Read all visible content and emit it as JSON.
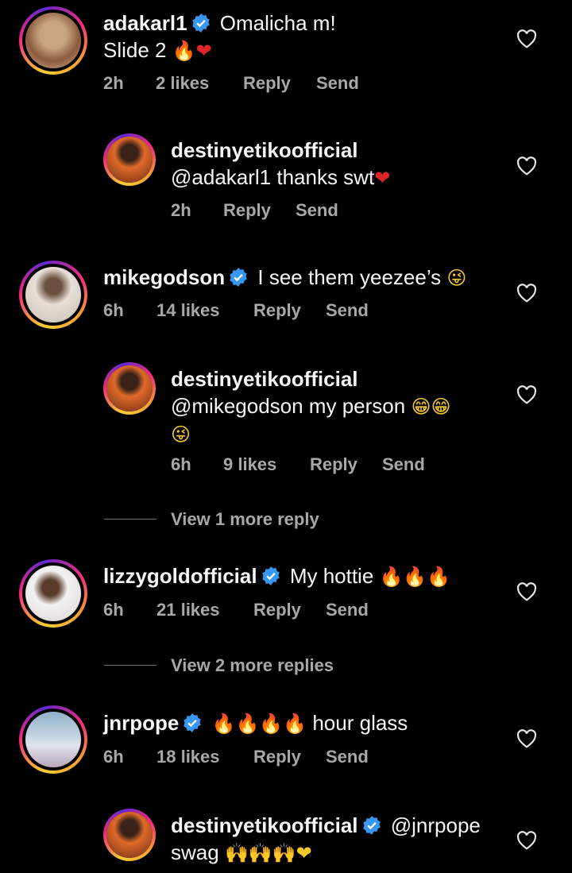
{
  "comments": [
    {
      "username": "adakarl1",
      "verified": true,
      "text_line1": "Omalicha m!",
      "text_line2": "Slide 2",
      "emojis": "🔥❤",
      "time": "2h",
      "likes": "2 likes",
      "reply": "Reply",
      "send": "Send",
      "avatar_colors": [
        "#c9a582",
        "#8a5a3c"
      ]
    },
    {
      "username": "destinyetikoofficial",
      "verified": false,
      "text": "@adakarl1 thanks swt",
      "emojis": "❤",
      "time": "2h",
      "reply": "Reply",
      "send": "Send",
      "avatar_colors": [
        "#e06a28",
        "#6a2c1a"
      ]
    },
    {
      "username": "mikegodson",
      "verified": true,
      "text": "I see them yeezee’s",
      "emojis": "😜",
      "time": "6h",
      "likes": "14 likes",
      "reply": "Reply",
      "send": "Send",
      "avatar_colors": [
        "#e8e0d8",
        "#6b5040"
      ]
    },
    {
      "username": "destinyetikoofficial",
      "verified": false,
      "text": "@mikegodson my person",
      "emojis": "😁😁",
      "emojis_line2": "😜",
      "time": "6h",
      "likes": "9 likes",
      "reply": "Reply",
      "send": "Send",
      "avatar_colors": [
        "#e06a28",
        "#6a2c1a"
      ]
    },
    {
      "username": "lizzygoldofficial",
      "verified": true,
      "text": "My hottie",
      "emojis": "🔥🔥🔥",
      "time": "6h",
      "likes": "21 likes",
      "reply": "Reply",
      "send": "Send",
      "avatar_colors": [
        "#f2f2f2",
        "#5a3a2a"
      ]
    },
    {
      "username": "jnrpope",
      "verified": true,
      "text": "hour glass",
      "emojis": "🔥🔥🔥🔥",
      "time": "6h",
      "likes": "18 likes",
      "reply": "Reply",
      "send": "Send",
      "avatar_colors": [
        "#8fb0c8",
        "#e0e4ec"
      ]
    },
    {
      "username": "destinyetikoofficial",
      "verified": true,
      "text": "@jnrpope",
      "text_line2": "swag",
      "emojis": "🙌🙌🙌❤",
      "avatar_colors": [
        "#e06a28",
        "#6a2c1a"
      ]
    }
  ],
  "view_more": [
    "View 1 more reply",
    "View 2 more replies"
  ],
  "colors": {
    "background": "#000000",
    "meta": "#a8a8a8",
    "verified": "#3897f0"
  }
}
